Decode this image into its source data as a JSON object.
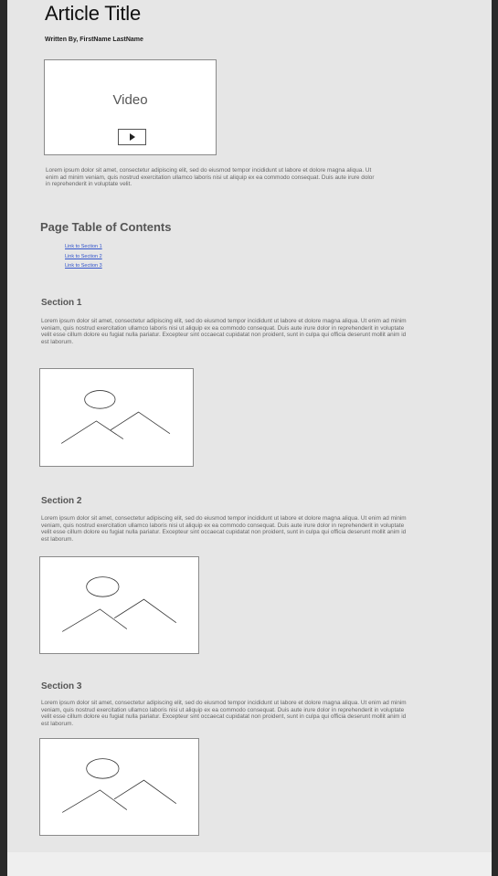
{
  "article": {
    "title": "Article Title",
    "byline": "Written By, FirstName LastName"
  },
  "video": {
    "label": "Video",
    "play_icon": "play-icon"
  },
  "intro": {
    "text": "Lorem ipsum dolor sit amet, consectetur adipiscing elit, sed do eiusmod tempor incididunt ut labore et dolore magna aliqua. Ut enim ad minim veniam, quis nostrud exercitation ullamco laboris nisi ut aliquip ex ea commodo consequat. Duis aute irure dolor in reprehenderit in voluptate velit."
  },
  "toc": {
    "title": "Page Table of Contents",
    "links": [
      {
        "label": "Link to Section 1"
      },
      {
        "label": "Link to Section 2"
      },
      {
        "label": "Link to Section 3"
      }
    ]
  },
  "sections": [
    {
      "title": "Section 1",
      "body": "Lorem ipsum dolor sit amet, consectetur adipiscing elit, sed do eiusmod tempor incididunt ut labore et dolore magna aliqua. Ut enim ad minim veniam, quis nostrud exercitation ullamco laboris nisi ut aliquip ex ea commodo consequat. Duis aute irure dolor in reprehenderit in voluptate velit esse cillum dolore eu fugiat nulla pariatur. Excepteur sint occaecat cupidatat non proident, sunt in culpa qui officia deserunt mollit anim id est laborum.",
      "image_icon": "image-placeholder-icon"
    },
    {
      "title": "Section 2",
      "body": "Lorem ipsum dolor sit amet, consectetur adipiscing elit, sed do eiusmod tempor incididunt ut labore et dolore magna aliqua. Ut enim ad minim veniam, quis nostrud exercitation ullamco laboris nisi ut aliquip ex ea commodo consequat. Duis aute irure dolor in reprehenderit in voluptate velit esse cillum dolore eu fugiat nulla pariatur. Excepteur sint occaecat cupidatat non proident, sunt in culpa qui officia deserunt mollit anim id est laborum.",
      "image_icon": "image-placeholder-icon"
    },
    {
      "title": "Section 3",
      "body": "Lorem ipsum dolor sit amet, consectetur adipiscing elit, sed do eiusmod tempor incididunt ut labore et dolore magna aliqua. Ut enim ad minim veniam, quis nostrud exercitation ullamco laboris nisi ut aliquip ex ea commodo consequat. Duis aute irure dolor in reprehenderit in voluptate velit esse cillum dolore eu fugiat nulla pariatur. Excepteur sint occaecat cupidatat non proident, sunt in culpa qui officia deserunt mollit anim id est laborum.",
      "image_icon": "image-placeholder-icon"
    }
  ],
  "colors": {
    "page_background": "#e6e6e6",
    "outer_background": "#2a2a2a",
    "link": "#3355cc",
    "heading": "#555555"
  }
}
